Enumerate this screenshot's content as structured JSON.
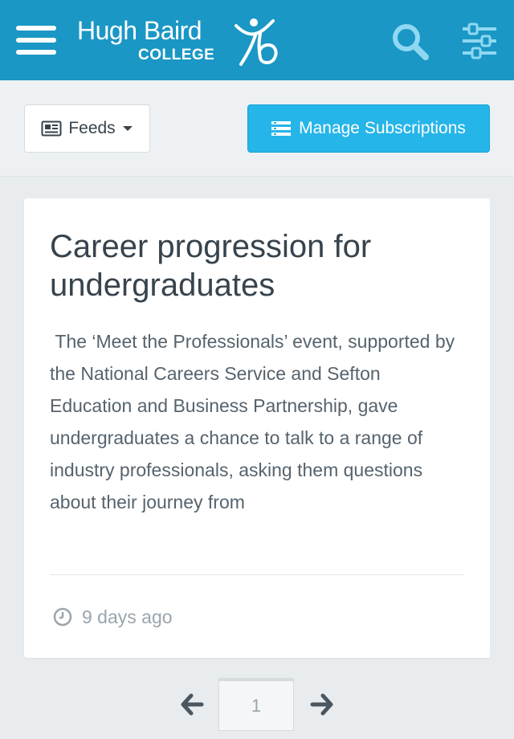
{
  "header": {
    "brand_line1": "Hugh Baird",
    "brand_line2": "COLLEGE",
    "menu_icon": "hamburger-icon",
    "search_icon": "search-icon",
    "filter_icon": "sliders-icon",
    "bg_color": "#1a97c4"
  },
  "toolbar": {
    "feeds_label": "Feeds",
    "feeds_icon": "newspaper-icon",
    "manage_label": "Manage Subscriptions",
    "manage_icon": "list-icon",
    "manage_color": "#26b5e8"
  },
  "article": {
    "title": "Career progression for undergraduates",
    "excerpt": " The ‘Meet the Professionals’ event, supported by the National Careers Service and Sefton Education and Business Partnership, gave undergraduates a chance to talk to a range of industry professionals, asking them questions about their journey from",
    "time_ago": "9 days ago",
    "time_icon": "clock-icon"
  },
  "pagination": {
    "current_page": "1",
    "prev_icon": "arrow-left-icon",
    "next_icon": "arrow-right-icon"
  }
}
